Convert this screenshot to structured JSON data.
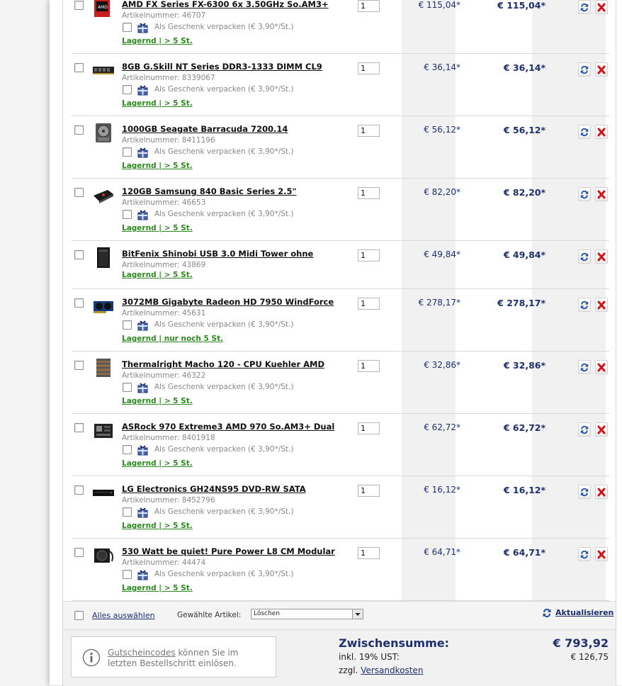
{
  "colors": {
    "price": "#1d2f6e",
    "stock": "#2c8a1e",
    "delete": "#d0151b",
    "update": "#1d4fa0"
  },
  "items": [
    {
      "title": "AMD FX Series FX-6300 6x 3.50GHz So.AM3+",
      "artnr_label": "Artikelnummer:",
      "artnr": "46707",
      "gift_label": "Als Geschenk verpacken (€ 3,90*/St.)",
      "stock": "Lagernd | > 5 St.",
      "qty": "1",
      "price": "€ 115,04*",
      "total": "€ 115,04*",
      "icon": "cpu-box-icon"
    },
    {
      "title": "8GB G.Skill NT Series DDR3-1333 DIMM CL9",
      "artnr_label": "Artikelnummer:",
      "artnr": "8339067",
      "gift_label": "Als Geschenk verpacken (€ 3,90*/St.)",
      "stock": "Lagernd | > 5 St.",
      "qty": "1",
      "price": "€ 36,14*",
      "total": "€ 36,14*",
      "icon": "ram-module-icon"
    },
    {
      "title": "1000GB Seagate Barracuda 7200.14",
      "artnr_label": "Artikelnummer:",
      "artnr": "8411196",
      "gift_label": "Als Geschenk verpacken (€ 3,90*/St.)",
      "stock": "Lagernd | > 5 St.",
      "qty": "1",
      "price": "€ 56,12*",
      "total": "€ 56,12*",
      "icon": "hard-drive-icon"
    },
    {
      "title": "120GB Samsung 840 Basic Series 2.5\"",
      "artnr_label": "Artikelnummer:",
      "artnr": "46653",
      "gift_label": "Als Geschenk verpacken (€ 3,90*/St.)",
      "stock": "Lagernd | > 5 St.",
      "qty": "1",
      "price": "€ 82,20*",
      "total": "€ 82,20*",
      "icon": "ssd-icon"
    },
    {
      "title": "BitFenix Shinobi USB 3.0 Midi Tower ohne",
      "artnr_label": "Artikelnummer:",
      "artnr": "43869",
      "gift_label": "",
      "stock": "Lagernd | > 5 St.",
      "qty": "1",
      "price": "€ 49,84*",
      "total": "€ 49,84*",
      "icon": "pc-case-icon"
    },
    {
      "title": "3072MB Gigabyte Radeon HD 7950 WindForce",
      "artnr_label": "Artikelnummer:",
      "artnr": "45631",
      "gift_label": "Als Geschenk verpacken (€ 3,90*/St.)",
      "stock": "Lagernd | nur noch 5 St.",
      "qty": "1",
      "price": "€ 278,17*",
      "total": "€ 278,17*",
      "icon": "graphics-card-icon"
    },
    {
      "title": "Thermalright Macho 120 - CPU Kuehler AMD",
      "artnr_label": "Artikelnummer:",
      "artnr": "46322",
      "gift_label": "Als Geschenk verpacken (€ 3,90*/St.)",
      "stock": "Lagernd | > 5 St.",
      "qty": "1",
      "price": "€ 32,86*",
      "total": "€ 32,86*",
      "icon": "cpu-cooler-icon"
    },
    {
      "title": "ASRock 970 Extreme3 AMD 970 So.AM3+ Dual",
      "artnr_label": "Artikelnummer:",
      "artnr": "8401918",
      "gift_label": "Als Geschenk verpacken (€ 3,90*/St.)",
      "stock": "Lagernd | > 5 St.",
      "qty": "1",
      "price": "€ 62,72*",
      "total": "€ 62,72*",
      "icon": "motherboard-icon"
    },
    {
      "title": "LG Electronics GH24NS95 DVD-RW SATA",
      "artnr_label": "Artikelnummer:",
      "artnr": "8452796",
      "gift_label": "Als Geschenk verpacken (€ 3,90*/St.)",
      "stock": "Lagernd | > 5 St.",
      "qty": "1",
      "price": "€ 16,12*",
      "total": "€ 16,12*",
      "icon": "dvd-drive-icon"
    },
    {
      "title": "530 Watt be quiet! Pure Power L8 CM Modular",
      "artnr_label": "Artikelnummer:",
      "artnr": "44474",
      "gift_label": "Als Geschenk verpacken (€ 3,90*/St.)",
      "stock": "Lagernd | > 5 St.",
      "qty": "1",
      "price": "€ 64,71*",
      "total": "€ 64,71*",
      "icon": "power-supply-icon"
    }
  ],
  "footer": {
    "select_all": "Alles auswählen",
    "selected_label": "Gewählte Artikel:",
    "action_value": "Löschen",
    "refresh": "Aktualisieren"
  },
  "coupon": {
    "link": "Gutscheincodes",
    "text1": " können Sie im",
    "text2": "letzten Bestellschritt einlösen."
  },
  "summary": {
    "subtotal_label": "Zwischensumme:",
    "subtotal": "€ 793,92",
    "vat_label": "inkl. 19% UST:",
    "vat": "€ 126,75",
    "shipping_prefix": "zzgl. ",
    "shipping_link": "Versandkosten"
  }
}
